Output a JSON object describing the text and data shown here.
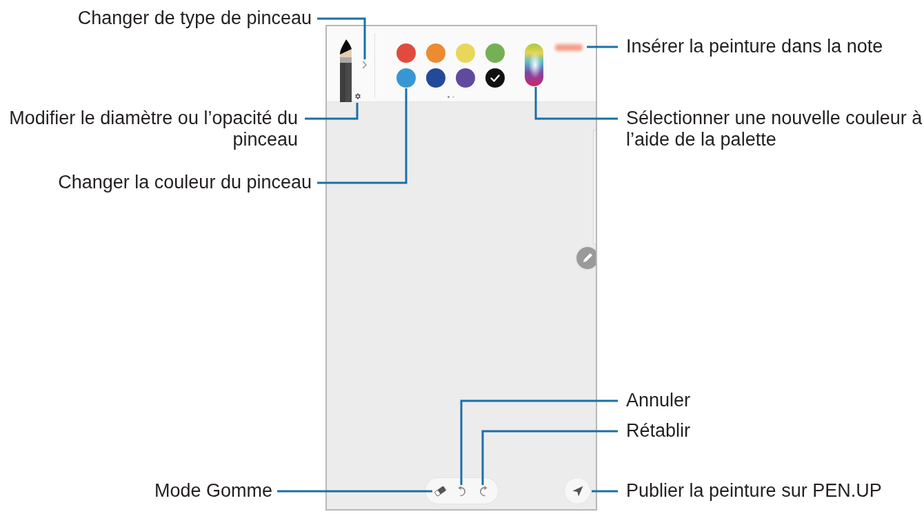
{
  "left_callouts": [
    "Changer de type de pinceau",
    "Modifier le diamètre ou l’opacité du pinceau",
    "Changer la couleur du pinceau",
    "Mode Gomme"
  ],
  "right_callouts": [
    "Insérer la peinture dans la note",
    "Sélectionner une nouvelle couleur à l’aide de la palette",
    "Annuler",
    "Rétablir",
    "Publier la peinture sur PEN.UP"
  ],
  "toolbar": {
    "colors": [
      {
        "color": "#e14b3f",
        "selected": false
      },
      {
        "color": "#ec8b30",
        "selected": false
      },
      {
        "color": "#e8d75b",
        "selected": false
      },
      {
        "color": "#76b054",
        "selected": false
      },
      {
        "color": "#3897d3",
        "selected": false
      },
      {
        "color": "#22499a",
        "selected": false
      },
      {
        "color": "#5f4a9e",
        "selected": false
      },
      {
        "color": "#111111",
        "selected": true
      }
    ],
    "page_dots": [
      {
        "selected": true
      },
      {
        "selected": false
      }
    ]
  }
}
